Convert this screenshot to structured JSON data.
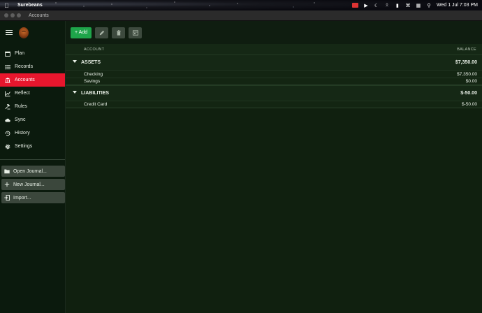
{
  "menubar": {
    "app_name": "Surebeans",
    "clock": "Wed 1 Jul  7:03 PM"
  },
  "window": {
    "title": "Accounts"
  },
  "sidebar": {
    "items": [
      {
        "label": "Plan",
        "icon": "calendar-icon",
        "active": false
      },
      {
        "label": "Records",
        "icon": "list-icon",
        "active": false
      },
      {
        "label": "Accounts",
        "icon": "bank-icon",
        "active": true
      },
      {
        "label": "Reflect",
        "icon": "chart-icon",
        "active": false
      },
      {
        "label": "Rules",
        "icon": "gavel-icon",
        "active": false
      },
      {
        "label": "Sync",
        "icon": "cloud-icon",
        "active": false
      },
      {
        "label": "History",
        "icon": "history-icon",
        "active": false
      },
      {
        "label": "Settings",
        "icon": "gear-icon",
        "active": false
      }
    ],
    "actions": [
      {
        "label": "Open Journal...",
        "icon": "folder-icon"
      },
      {
        "label": "New Journal...",
        "icon": "plus-icon"
      },
      {
        "label": "Import...",
        "icon": "import-icon"
      }
    ]
  },
  "toolbar": {
    "add_label": "+ Add",
    "edit_icon": "pencil-icon",
    "delete_icon": "trash-icon",
    "archive_icon": "archive-icon"
  },
  "table": {
    "col_account": "ACCOUNT",
    "col_balance": "BALANCE",
    "groups": [
      {
        "name": "ASSETS",
        "balance": "$7,350.00",
        "accounts": [
          {
            "name": "Checking",
            "balance": "$7,350.00"
          },
          {
            "name": "Savings",
            "balance": "$0.00"
          }
        ]
      },
      {
        "name": "LIABILITIES",
        "balance": "$-50.00",
        "accounts": [
          {
            "name": "Credit Card",
            "balance": "$-50.00"
          }
        ]
      }
    ]
  },
  "colors": {
    "accent_active": "#e8162d",
    "add_button": "#1ea54a",
    "background": "#10200f"
  }
}
